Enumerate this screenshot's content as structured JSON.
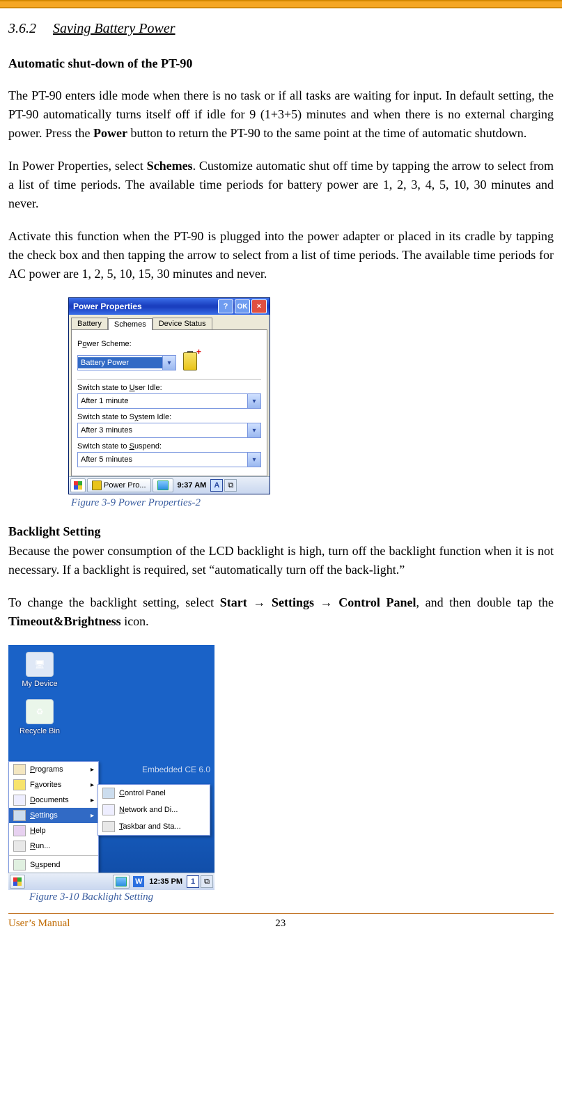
{
  "section": {
    "number": "3.6.2",
    "title": "Saving Battery Power"
  },
  "heading1": "Automatic shut-down of the PT-90",
  "para1a": "The PT-90 enters idle mode when there is no task or if all tasks are waiting for input. In default setting, the PT-90 automatically turns itself off if idle for 9 (1+3+5) minutes and when there is no external charging power. Press the ",
  "para1b": "Power",
  "para1c": " button to return the PT-90 to the same point at the time of automatic shutdown.",
  "para2a": "In Power Properties, select ",
  "para2b": "Schemes",
  "para2c": ". Customize automatic shut off time by tapping the arrow to select from a list of time periods. The available time periods for battery power are 1, 2, 3, 4, 5, 10, 30 minutes and never.",
  "para3": "Activate this function when the PT-90 is plugged into the power adapter or placed in its cradle by tapping the check box and then tapping the arrow to select from a list of time periods. The available time periods for AC power are 1, 2, 5, 10, 15, 30 minutes and never.",
  "fig1": {
    "caption": "Figure 3-9 Power Properties-2",
    "window_title": "Power Properties",
    "btn_help": "?",
    "btn_ok": "OK",
    "btn_close": "×",
    "tabs": {
      "battery": "Battery",
      "schemes": "Schemes",
      "device": "Device Status"
    },
    "labels": {
      "power_scheme_pre": "P",
      "power_scheme_u": "o",
      "power_scheme_post": "wer Scheme:",
      "user_idle_pre": "Switch state to ",
      "user_idle_u": "U",
      "user_idle_post": "ser Idle:",
      "sys_idle_pre": "Switch state to S",
      "sys_idle_u": "y",
      "sys_idle_post": "stem Idle:",
      "suspend_pre": "Switch state to ",
      "suspend_u": "S",
      "suspend_post": "uspend:"
    },
    "values": {
      "scheme": "Battery Power",
      "user_idle": "After 1 minute",
      "sys_idle": "After 3 minutes",
      "suspend": "After 5 minutes"
    },
    "taskbar": {
      "task": "Power Pro...",
      "clock": "9:37 AM",
      "tray_letter": "A"
    }
  },
  "heading2": "Backlight Setting",
  "para4": "Because the power consumption of the LCD backlight is high, turn off the backlight function when it is not necessary. If a backlight is required, set “automatically turn off the back-light.”",
  "para5a": "To change the backlight setting, select ",
  "para5b": "Start",
  "para5c": " → ",
  "para5d": "Settings",
  "para5e": " → ",
  "para5f": "Control Panel",
  "para5g": ", and then double tap the ",
  "para5h": "Timeout&Brightness",
  "para5i": " icon.",
  "fig2": {
    "caption": "Figure 3-10 Backlight Setting",
    "desktop": {
      "icon_mydevice": "My Device",
      "icon_recycle": "Recycle Bin",
      "watermark": "Embedded CE 6.0"
    },
    "start_menu": {
      "programs_pre": "",
      "programs_u": "P",
      "programs_post": "rograms",
      "favorites_pre": "F",
      "favorites_u": "a",
      "favorites_post": "vorites",
      "documents_pre": "",
      "documents_u": "D",
      "documents_post": "ocuments",
      "settings_pre": "",
      "settings_u": "S",
      "settings_post": "ettings",
      "help_pre": "",
      "help_u": "H",
      "help_post": "elp",
      "run_pre": "",
      "run_u": "R",
      "run_post": "un...",
      "suspend_pre": "S",
      "suspend_u": "u",
      "suspend_post": "spend"
    },
    "sub_menu": {
      "cp_pre": "",
      "cp_u": "C",
      "cp_post": "ontrol Panel",
      "net_pre": "",
      "net_u": "N",
      "net_post": "etwork and Di...",
      "task_pre": "",
      "task_u": "T",
      "task_post": "askbar and Sta..."
    },
    "taskbar": {
      "clock": "12:35 PM",
      "tray_W": "W",
      "tray_1": "1"
    }
  },
  "footer": {
    "left": "User’s Manual",
    "page": "23"
  }
}
